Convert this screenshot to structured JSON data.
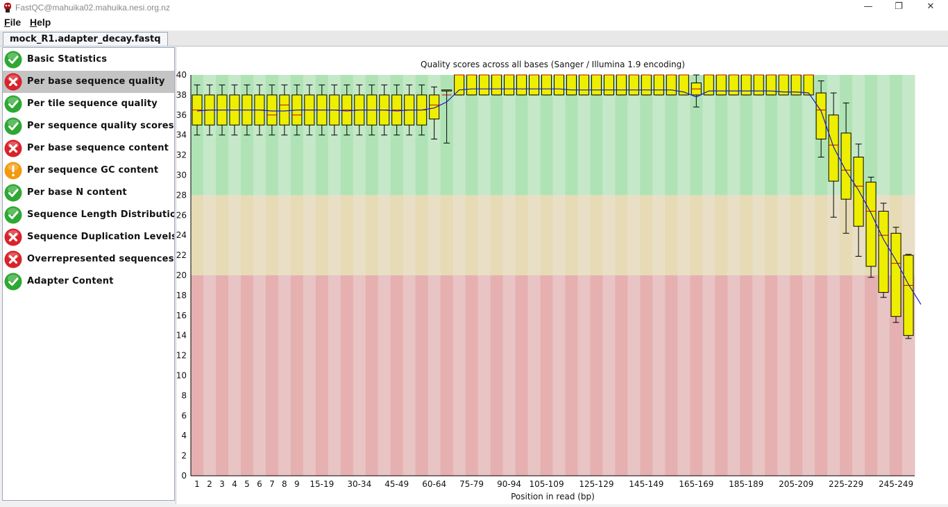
{
  "window": {
    "title": "FastQC@mahuika02.mahuika.nesi.org.nz"
  },
  "menu": {
    "items": [
      {
        "accel": "F",
        "rest": "ile"
      },
      {
        "accel": "H",
        "rest": "elp"
      }
    ]
  },
  "tab": {
    "label": "mock_R1.adapter_decay.fastq"
  },
  "sidebar": {
    "selected_index": 1,
    "items": [
      {
        "label": "Basic Statistics",
        "status": "pass"
      },
      {
        "label": "Per base sequence quality",
        "status": "fail"
      },
      {
        "label": "Per tile sequence quality",
        "status": "pass"
      },
      {
        "label": "Per sequence quality scores",
        "status": "pass"
      },
      {
        "label": "Per base sequence content",
        "status": "fail"
      },
      {
        "label": "Per sequence GC content",
        "status": "warn"
      },
      {
        "label": "Per base N content",
        "status": "pass"
      },
      {
        "label": "Sequence Length Distribution",
        "status": "pass"
      },
      {
        "label": "Sequence Duplication Levels",
        "status": "fail"
      },
      {
        "label": "Overrepresented sequences",
        "status": "fail"
      },
      {
        "label": "Adapter Content",
        "status": "pass"
      }
    ]
  },
  "colors": {
    "pass": "#2ea832",
    "fail": "#d8232a",
    "warn": "#f29a0c",
    "zone_good": [
      "#afe3b6",
      "#c5e8c8"
    ],
    "zone_ok": [
      "#e6dbb5",
      "#e8dfc6"
    ],
    "zone_bad": [
      "#e6b0b0",
      "#e8c4c4"
    ],
    "box_fill": "#eeee00",
    "median": "#cc0000",
    "mean_line": "#1a1acc"
  },
  "chart_data": {
    "type": "box",
    "title": "Quality scores across all bases (Sanger / Illumina 1.9 encoding)",
    "xlabel": "Position in read (bp)",
    "ylabel": "",
    "ylim": [
      0,
      40
    ],
    "yticks": [
      0,
      2,
      4,
      6,
      8,
      10,
      12,
      14,
      16,
      18,
      20,
      22,
      24,
      26,
      28,
      30,
      32,
      34,
      36,
      38,
      40
    ],
    "zones": {
      "good": [
        28,
        40
      ],
      "ok": [
        20,
        28
      ],
      "bad": [
        0,
        20
      ]
    },
    "categories": [
      "1",
      "2",
      "3",
      "4",
      "5",
      "6",
      "7",
      "8",
      "9",
      "10-14",
      "15-19",
      "20-24",
      "25-29",
      "30-34",
      "35-39",
      "40-44",
      "45-49",
      "50-54",
      "55-59",
      "60-64",
      "65-69",
      "70-74",
      "75-79",
      "80-84",
      "85-89",
      "90-94",
      "95-99",
      "100-104",
      "105-109",
      "110-114",
      "115-119",
      "120-124",
      "125-129",
      "130-134",
      "135-139",
      "140-144",
      "145-149",
      "150-154",
      "155-159",
      "160-164",
      "165-169",
      "170-174",
      "175-179",
      "180-184",
      "185-189",
      "190-194",
      "195-199",
      "200-204",
      "205-209",
      "210-214",
      "215-219",
      "220-224",
      "225-229",
      "230-234",
      "235-239",
      "240-244",
      "245-249",
      "250-251"
    ],
    "shown_tick_labels": [
      "1",
      "2",
      "3",
      "4",
      "5",
      "6",
      "7",
      "8",
      "9",
      "15-19",
      "30-34",
      "45-49",
      "60-64",
      "75-79",
      "90-94",
      "105-109",
      "125-129",
      "145-149",
      "165-169",
      "185-189",
      "205-209",
      "225-229",
      "245-249"
    ],
    "series": [
      {
        "name": "q1",
        "values": [
          35,
          35,
          35,
          35,
          35,
          35,
          35,
          35,
          35,
          35,
          35,
          35,
          35,
          35,
          35,
          35,
          35,
          35,
          35,
          35.6,
          38.4,
          38,
          38,
          38,
          38,
          38,
          38,
          38,
          38,
          38,
          38,
          38,
          38,
          38,
          38,
          38,
          38,
          38,
          38,
          38,
          38,
          38,
          38,
          38,
          38,
          38,
          38,
          38,
          38,
          38,
          33.6,
          29.4,
          27.6,
          24.9,
          20.9,
          18.3,
          15.9,
          14
        ]
      },
      {
        "name": "q3",
        "values": [
          38,
          38,
          38,
          38,
          38,
          38,
          38,
          38,
          38,
          38,
          38,
          38,
          38,
          38,
          38,
          38,
          38,
          38,
          38,
          38,
          38.5,
          40,
          40,
          40,
          40,
          40,
          40,
          40,
          40,
          40,
          40,
          40,
          40,
          40,
          40,
          40,
          40,
          40,
          40,
          40,
          39.2,
          40,
          40,
          40,
          40,
          40,
          40,
          40,
          40,
          40,
          38.2,
          36,
          34.2,
          31.8,
          29.3,
          26.4,
          24.2,
          22,
          20
        ]
      },
      {
        "name": "median",
        "values": [
          36.5,
          36.5,
          36.5,
          36.5,
          36.5,
          36.5,
          36,
          37,
          36,
          36.5,
          36.5,
          36.5,
          36.5,
          36.5,
          36.5,
          36.5,
          36.5,
          36.5,
          36.5,
          37,
          38,
          40,
          40,
          40,
          40,
          40,
          40,
          40,
          40,
          40,
          40,
          40,
          40,
          40,
          40,
          40,
          40,
          40,
          40,
          40,
          38.6,
          40,
          40,
          40,
          40,
          40,
          40,
          40,
          40,
          40,
          36.5,
          33,
          30.5,
          28.9,
          26.4,
          24,
          21.2,
          19,
          17
        ]
      },
      {
        "name": "lower",
        "values": [
          34,
          34,
          34,
          34,
          34,
          34,
          34,
          34,
          34,
          34,
          34,
          34,
          34,
          34,
          34,
          34,
          34,
          34,
          34,
          33.6,
          33.2,
          38,
          38,
          38,
          38,
          38,
          38,
          38,
          38,
          38,
          38,
          38,
          38,
          38,
          38,
          38,
          38,
          38,
          38,
          38,
          36.8,
          38,
          38,
          38,
          38,
          38,
          38,
          38,
          38,
          38,
          31.8,
          25.8,
          24.2,
          21.9,
          19.8,
          17.8,
          15.3,
          13.7,
          12.1
        ]
      },
      {
        "name": "upper",
        "values": [
          39,
          39,
          39,
          39,
          39,
          39,
          39,
          39,
          39,
          39,
          39,
          39,
          39,
          39,
          39,
          39,
          39,
          39,
          39,
          38.8,
          38.4,
          40,
          40,
          40,
          40,
          40,
          40,
          40,
          40,
          40,
          40,
          40,
          40,
          40,
          40,
          40,
          40,
          40,
          40,
          40,
          40,
          40,
          40,
          40,
          40,
          40,
          40,
          40,
          40,
          40,
          39.4,
          38.2,
          37.2,
          33.1,
          29.8,
          27.2,
          24.8,
          22.1
        ]
      },
      {
        "name": "mean",
        "values": [
          36.4,
          36.5,
          36.5,
          36.5,
          36.5,
          36.5,
          36.4,
          36.4,
          36.5,
          36.5,
          36.5,
          36.5,
          36.4,
          36.5,
          36.5,
          36.5,
          36.4,
          36.5,
          36.5,
          36.7,
          37.3,
          38.5,
          38.6,
          38.6,
          38.6,
          38.6,
          38.6,
          38.6,
          38.6,
          38.6,
          38.5,
          38.5,
          38.5,
          38.5,
          38.5,
          38.5,
          38.5,
          38.5,
          38.5,
          38.3,
          37.8,
          38.4,
          38.4,
          38.4,
          38.4,
          38.4,
          38.4,
          38.3,
          38.3,
          38.2,
          36.4,
          32.8,
          30.4,
          28.5,
          26.2,
          23.6,
          21.5,
          19.1,
          17.1
        ]
      }
    ]
  }
}
